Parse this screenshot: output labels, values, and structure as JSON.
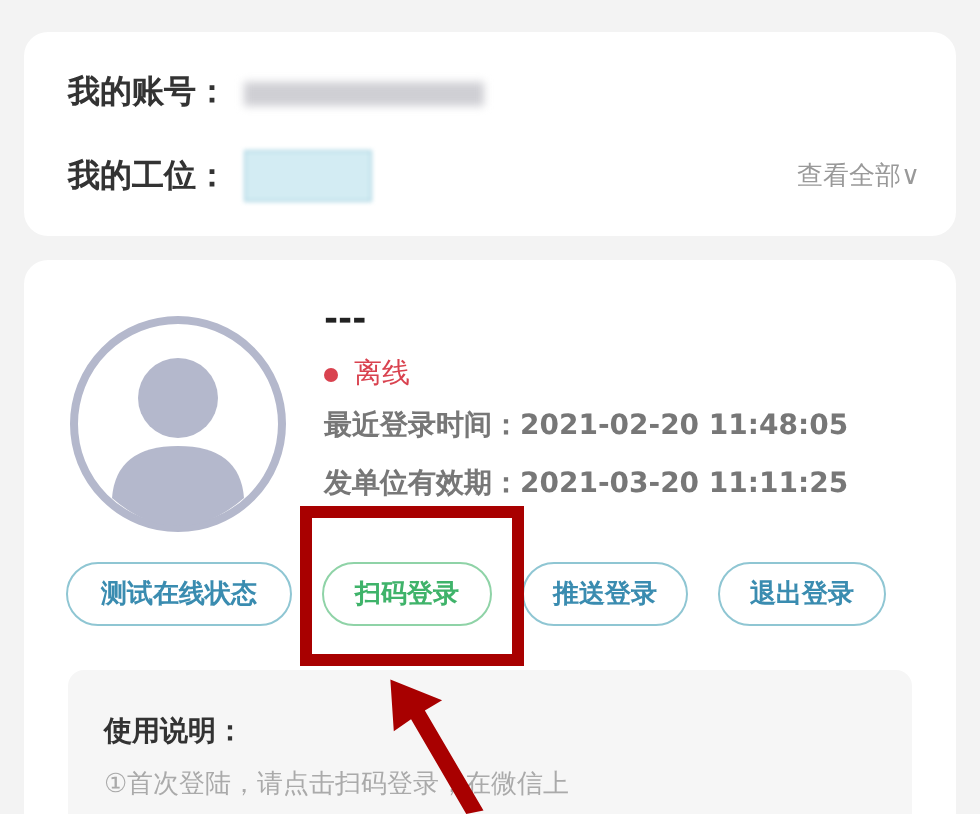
{
  "account_card": {
    "account_label": "我的账号：",
    "station_label": "我的工位：",
    "view_all": "查看全部∨"
  },
  "device_card": {
    "name": "---",
    "status": {
      "label": "离线",
      "online": false
    },
    "last_login": "最近登录时间：2021-02-20 11:48:05",
    "valid_until": "发单位有效期：2021-03-20 11:11:25",
    "buttons": [
      {
        "label": "测试在线状态",
        "highlighted": false
      },
      {
        "label": "扫码登录",
        "highlighted": true
      },
      {
        "label": "推送登录",
        "highlighted": false
      },
      {
        "label": "退出登录",
        "highlighted": false
      }
    ],
    "instructions": {
      "title": "使用说明：",
      "lines": [
        "①首次登陆，请点击扫码登录，在微信上"
      ]
    }
  },
  "annotation": {
    "kind": "box-and-arrow"
  }
}
